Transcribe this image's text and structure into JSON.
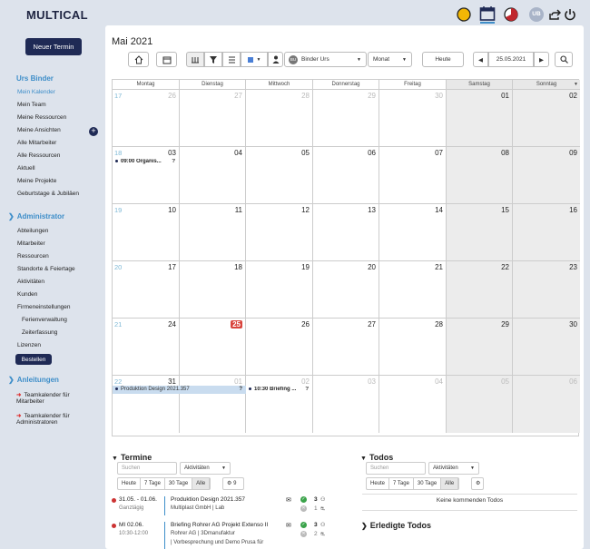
{
  "app": {
    "title": "MULTICAL"
  },
  "sidebar": {
    "new_button": "Neuer Termin",
    "user_header": "Urs Binder",
    "user_items": [
      "Mein Kalender",
      "Mein Team",
      "Meine Ressourcen",
      "Meine Ansichten",
      "Alle Mitarbeiter",
      "Alle Ressourcen",
      "Aktuell",
      "Meine Projekte",
      "Geburtstage & Jubiläen"
    ],
    "admin_header": "Administrator",
    "admin_items": [
      "Abteilungen",
      "Mitarbeiter",
      "Ressourcen",
      "Standorte & Feiertage",
      "Aktivitäten",
      "Kunden",
      "Firmeneinstellungen"
    ],
    "admin_sub_items": [
      "Ferienverwaltung",
      "Zeiterfassung"
    ],
    "licenses": "Lizenzen",
    "order_button": "Bestellen",
    "guides_header": "Anleitungen",
    "guides": [
      "Teamkalender für Mitarbeiter",
      "Teamkalender für Administratoren"
    ]
  },
  "header": {
    "avatar": "UB"
  },
  "toolbar": {
    "person_select": "Binder Urs",
    "person_initials": "BU",
    "view_select": "Monat",
    "today_button": "Heute",
    "date": "25.05.2021"
  },
  "calendar": {
    "month_title": "Mai 2021",
    "weekdays": [
      "Montag",
      "Dienstag",
      "Mittwoch",
      "Donnerstag",
      "Freitag",
      "Samstag",
      "Sonntag"
    ],
    "weeks": [
      {
        "wk": "17",
        "days": [
          "26",
          "27",
          "28",
          "29",
          "30",
          "01",
          "02"
        ],
        "muted": [
          true,
          true,
          true,
          true,
          true,
          false,
          false
        ]
      },
      {
        "wk": "18",
        "days": [
          "03",
          "04",
          "05",
          "06",
          "07",
          "08",
          "09"
        ],
        "muted": [
          false,
          false,
          false,
          false,
          false,
          false,
          false
        ]
      },
      {
        "wk": "19",
        "days": [
          "10",
          "11",
          "12",
          "13",
          "14",
          "15",
          "16"
        ],
        "muted": [
          false,
          false,
          false,
          false,
          false,
          false,
          false
        ]
      },
      {
        "wk": "20",
        "days": [
          "17",
          "18",
          "19",
          "20",
          "21",
          "22",
          "23"
        ],
        "muted": [
          false,
          false,
          false,
          false,
          false,
          false,
          false
        ]
      },
      {
        "wk": "21",
        "days": [
          "24",
          "25",
          "26",
          "27",
          "28",
          "29",
          "30"
        ],
        "muted": [
          false,
          false,
          false,
          false,
          false,
          false,
          false
        ]
      },
      {
        "wk": "22",
        "days": [
          "31",
          "01",
          "02",
          "03",
          "04",
          "05",
          "06"
        ],
        "muted": [
          false,
          true,
          true,
          true,
          true,
          true,
          true
        ]
      }
    ],
    "today": "25",
    "events": {
      "organisation": "09:00 Organis...",
      "organisation_q": "?",
      "production": "Produktion Design 2021.357",
      "production_q": "?",
      "briefing": "10:30 Briefing ...",
      "briefing_q": "?"
    }
  },
  "appointments": {
    "title": "Termine",
    "search_placeholder": "Suchen",
    "activity_select": "Aktivitäten",
    "filters": [
      "Heute",
      "7 Tage",
      "30 Tage",
      "Alle"
    ],
    "count": "9",
    "items": [
      {
        "date": "31.05. - 01.06.",
        "time": "Ganztägig",
        "title": "Produktion Design 2021.357",
        "client": "Multiplast GmbH | Lab",
        "extra": "",
        "accepted": "3",
        "declined": "1"
      },
      {
        "date": "MI 02.06.",
        "time": "10:30-12:00",
        "title": "Briefing Rohrer AG Projekt Extenso II",
        "client": "Rohrer AG | 3Dmanufaktur",
        "extra": "| Vorbesprechung und Demo Prusa für",
        "accepted": "3",
        "declined": "2"
      }
    ]
  },
  "todos": {
    "title": "Todos",
    "search_placeholder": "Suchen",
    "activity_select": "Aktivitäten",
    "filters": [
      "Heute",
      "7 Tage",
      "30 Tage",
      "Alle"
    ],
    "empty": "Keine kommenden Todos",
    "done_title": "Erledigte Todos"
  }
}
